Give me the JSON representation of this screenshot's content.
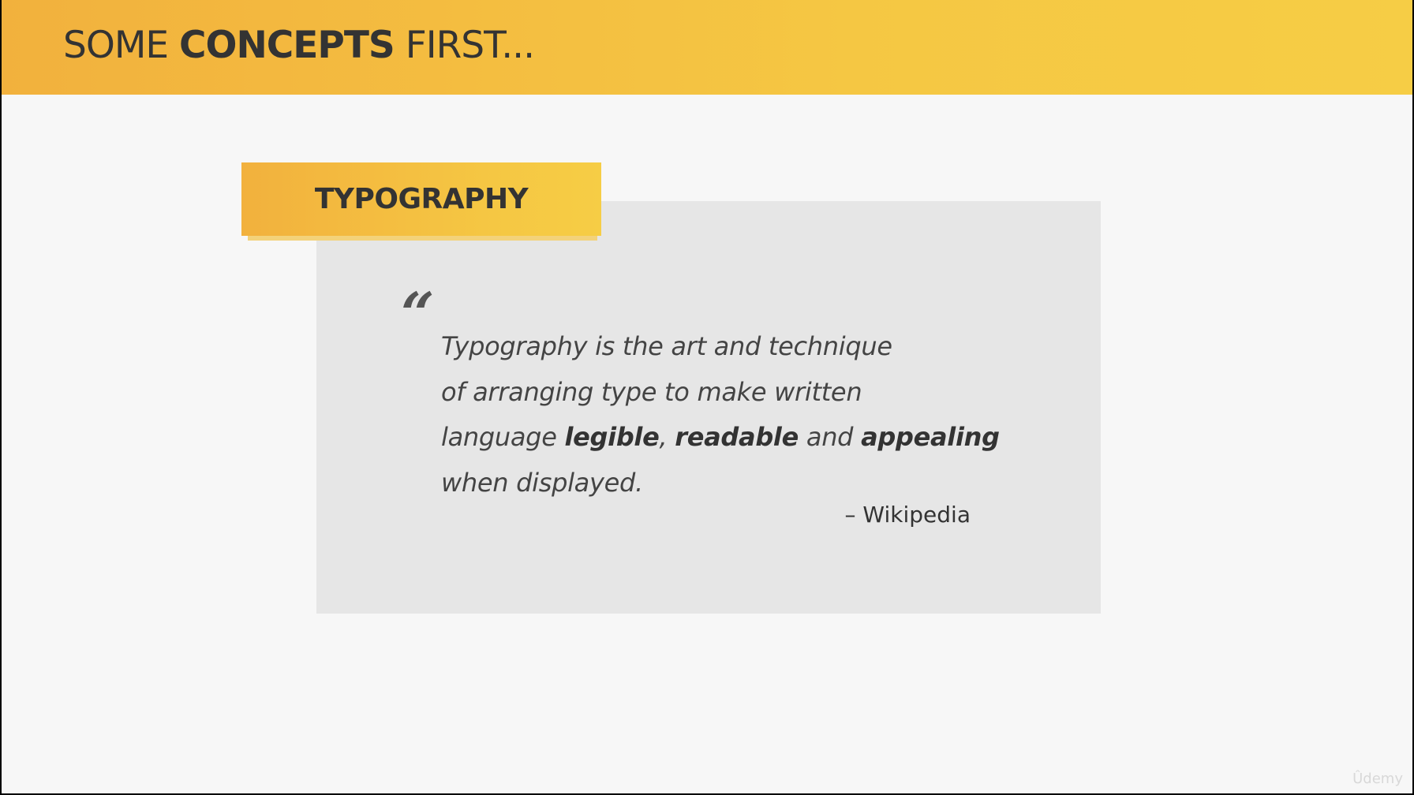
{
  "header": {
    "title_prefix": "SOME ",
    "title_bold": "CONCEPTS",
    "title_suffix": " FIRST..."
  },
  "section": {
    "tag_label": "TYPOGRAPHY"
  },
  "quote": {
    "mark": "“",
    "line1": "Typography is the art and technique",
    "line2": "of arranging type to make written",
    "line3_pre": "language ",
    "line3_bold1": "legible",
    "line3_sep": ", ",
    "line3_bold2": "readable",
    "line3_and": " and ",
    "line3_bold3": "appealing",
    "line4": "when displayed.",
    "attribution": "– Wikipedia"
  },
  "watermark": "Ûdemy",
  "colors": {
    "accent_start": "#f2b13d",
    "accent_end": "#f6cd45",
    "quote_box": "#e6e6e6",
    "text": "#333333"
  }
}
